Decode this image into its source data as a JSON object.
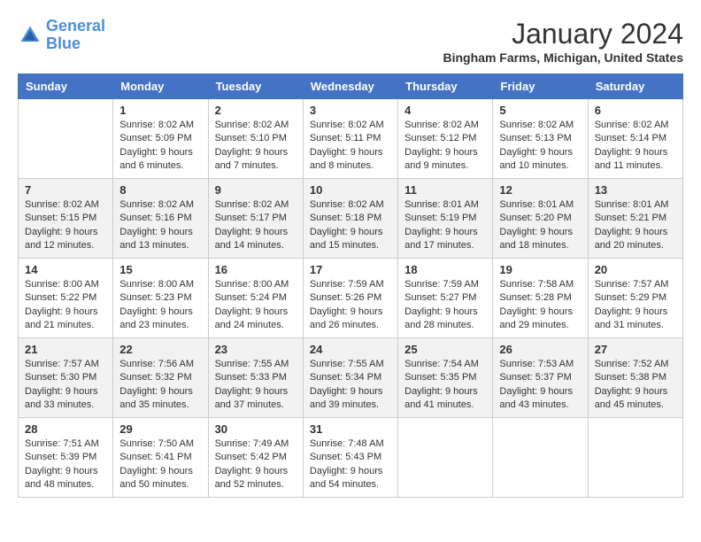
{
  "logo": {
    "line1": "General",
    "line2": "Blue"
  },
  "title": "January 2024",
  "location": "Bingham Farms, Michigan, United States",
  "headers": [
    "Sunday",
    "Monday",
    "Tuesday",
    "Wednesday",
    "Thursday",
    "Friday",
    "Saturday"
  ],
  "weeks": [
    [
      {
        "day": "",
        "sunrise": "",
        "sunset": "",
        "daylight": ""
      },
      {
        "day": "1",
        "sunrise": "Sunrise: 8:02 AM",
        "sunset": "Sunset: 5:09 PM",
        "daylight": "Daylight: 9 hours and 6 minutes."
      },
      {
        "day": "2",
        "sunrise": "Sunrise: 8:02 AM",
        "sunset": "Sunset: 5:10 PM",
        "daylight": "Daylight: 9 hours and 7 minutes."
      },
      {
        "day": "3",
        "sunrise": "Sunrise: 8:02 AM",
        "sunset": "Sunset: 5:11 PM",
        "daylight": "Daylight: 9 hours and 8 minutes."
      },
      {
        "day": "4",
        "sunrise": "Sunrise: 8:02 AM",
        "sunset": "Sunset: 5:12 PM",
        "daylight": "Daylight: 9 hours and 9 minutes."
      },
      {
        "day": "5",
        "sunrise": "Sunrise: 8:02 AM",
        "sunset": "Sunset: 5:13 PM",
        "daylight": "Daylight: 9 hours and 10 minutes."
      },
      {
        "day": "6",
        "sunrise": "Sunrise: 8:02 AM",
        "sunset": "Sunset: 5:14 PM",
        "daylight": "Daylight: 9 hours and 11 minutes."
      }
    ],
    [
      {
        "day": "7",
        "sunrise": "Sunrise: 8:02 AM",
        "sunset": "Sunset: 5:15 PM",
        "daylight": "Daylight: 9 hours and 12 minutes."
      },
      {
        "day": "8",
        "sunrise": "Sunrise: 8:02 AM",
        "sunset": "Sunset: 5:16 PM",
        "daylight": "Daylight: 9 hours and 13 minutes."
      },
      {
        "day": "9",
        "sunrise": "Sunrise: 8:02 AM",
        "sunset": "Sunset: 5:17 PM",
        "daylight": "Daylight: 9 hours and 14 minutes."
      },
      {
        "day": "10",
        "sunrise": "Sunrise: 8:02 AM",
        "sunset": "Sunset: 5:18 PM",
        "daylight": "Daylight: 9 hours and 15 minutes."
      },
      {
        "day": "11",
        "sunrise": "Sunrise: 8:01 AM",
        "sunset": "Sunset: 5:19 PM",
        "daylight": "Daylight: 9 hours and 17 minutes."
      },
      {
        "day": "12",
        "sunrise": "Sunrise: 8:01 AM",
        "sunset": "Sunset: 5:20 PM",
        "daylight": "Daylight: 9 hours and 18 minutes."
      },
      {
        "day": "13",
        "sunrise": "Sunrise: 8:01 AM",
        "sunset": "Sunset: 5:21 PM",
        "daylight": "Daylight: 9 hours and 20 minutes."
      }
    ],
    [
      {
        "day": "14",
        "sunrise": "Sunrise: 8:00 AM",
        "sunset": "Sunset: 5:22 PM",
        "daylight": "Daylight: 9 hours and 21 minutes."
      },
      {
        "day": "15",
        "sunrise": "Sunrise: 8:00 AM",
        "sunset": "Sunset: 5:23 PM",
        "daylight": "Daylight: 9 hours and 23 minutes."
      },
      {
        "day": "16",
        "sunrise": "Sunrise: 8:00 AM",
        "sunset": "Sunset: 5:24 PM",
        "daylight": "Daylight: 9 hours and 24 minutes."
      },
      {
        "day": "17",
        "sunrise": "Sunrise: 7:59 AM",
        "sunset": "Sunset: 5:26 PM",
        "daylight": "Daylight: 9 hours and 26 minutes."
      },
      {
        "day": "18",
        "sunrise": "Sunrise: 7:59 AM",
        "sunset": "Sunset: 5:27 PM",
        "daylight": "Daylight: 9 hours and 28 minutes."
      },
      {
        "day": "19",
        "sunrise": "Sunrise: 7:58 AM",
        "sunset": "Sunset: 5:28 PM",
        "daylight": "Daylight: 9 hours and 29 minutes."
      },
      {
        "day": "20",
        "sunrise": "Sunrise: 7:57 AM",
        "sunset": "Sunset: 5:29 PM",
        "daylight": "Daylight: 9 hours and 31 minutes."
      }
    ],
    [
      {
        "day": "21",
        "sunrise": "Sunrise: 7:57 AM",
        "sunset": "Sunset: 5:30 PM",
        "daylight": "Daylight: 9 hours and 33 minutes."
      },
      {
        "day": "22",
        "sunrise": "Sunrise: 7:56 AM",
        "sunset": "Sunset: 5:32 PM",
        "daylight": "Daylight: 9 hours and 35 minutes."
      },
      {
        "day": "23",
        "sunrise": "Sunrise: 7:55 AM",
        "sunset": "Sunset: 5:33 PM",
        "daylight": "Daylight: 9 hours and 37 minutes."
      },
      {
        "day": "24",
        "sunrise": "Sunrise: 7:55 AM",
        "sunset": "Sunset: 5:34 PM",
        "daylight": "Daylight: 9 hours and 39 minutes."
      },
      {
        "day": "25",
        "sunrise": "Sunrise: 7:54 AM",
        "sunset": "Sunset: 5:35 PM",
        "daylight": "Daylight: 9 hours and 41 minutes."
      },
      {
        "day": "26",
        "sunrise": "Sunrise: 7:53 AM",
        "sunset": "Sunset: 5:37 PM",
        "daylight": "Daylight: 9 hours and 43 minutes."
      },
      {
        "day": "27",
        "sunrise": "Sunrise: 7:52 AM",
        "sunset": "Sunset: 5:38 PM",
        "daylight": "Daylight: 9 hours and 45 minutes."
      }
    ],
    [
      {
        "day": "28",
        "sunrise": "Sunrise: 7:51 AM",
        "sunset": "Sunset: 5:39 PM",
        "daylight": "Daylight: 9 hours and 48 minutes."
      },
      {
        "day": "29",
        "sunrise": "Sunrise: 7:50 AM",
        "sunset": "Sunset: 5:41 PM",
        "daylight": "Daylight: 9 hours and 50 minutes."
      },
      {
        "day": "30",
        "sunrise": "Sunrise: 7:49 AM",
        "sunset": "Sunset: 5:42 PM",
        "daylight": "Daylight: 9 hours and 52 minutes."
      },
      {
        "day": "31",
        "sunrise": "Sunrise: 7:48 AM",
        "sunset": "Sunset: 5:43 PM",
        "daylight": "Daylight: 9 hours and 54 minutes."
      },
      {
        "day": "",
        "sunrise": "",
        "sunset": "",
        "daylight": ""
      },
      {
        "day": "",
        "sunrise": "",
        "sunset": "",
        "daylight": ""
      },
      {
        "day": "",
        "sunrise": "",
        "sunset": "",
        "daylight": ""
      }
    ]
  ]
}
